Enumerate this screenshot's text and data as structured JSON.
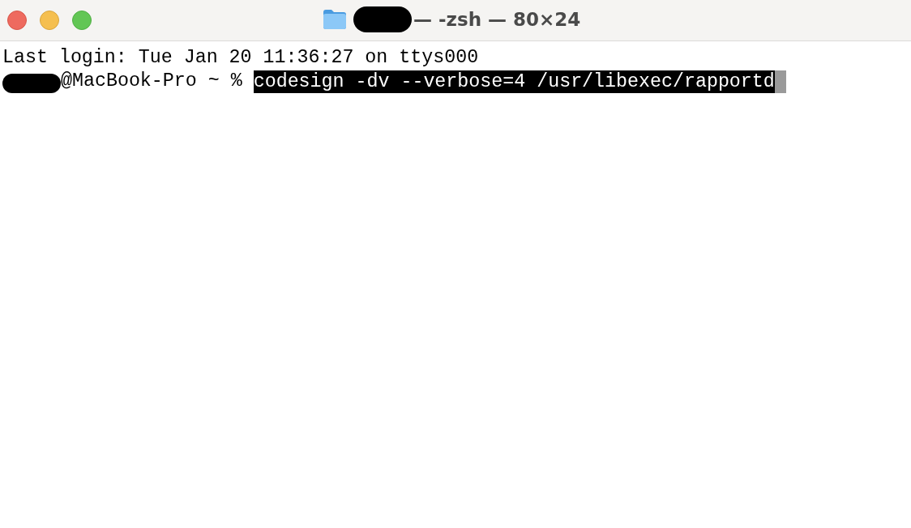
{
  "window": {
    "title": "— -zsh — 80×24"
  },
  "lines": [
    {
      "kind": "output",
      "text": "Last login: Tue Jan 20 11:36:27 on ttys000"
    },
    {
      "kind": "prompt",
      "prompt": "@MacBook-Pro ~ %",
      "command": "codesign -dv --verbose=4 /usr/libexec/rapportd",
      "selected": true
    }
  ]
}
